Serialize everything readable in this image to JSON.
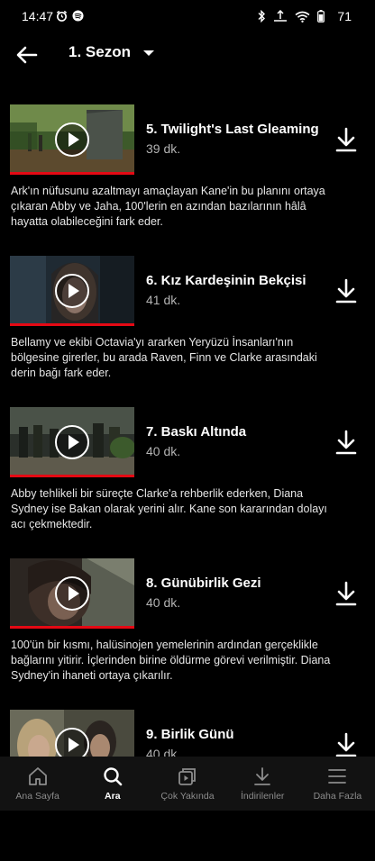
{
  "status_bar": {
    "time": "14:47",
    "battery": "71",
    "icons": [
      "alarm-icon",
      "spotify-icon",
      "bluetooth-icon",
      "data-saver-icon",
      "wifi-icon",
      "battery-icon"
    ]
  },
  "header": {
    "season_label": "1. Sezon",
    "back_icon": "arrow-left-icon",
    "dropdown_icon": "caret-down-icon"
  },
  "episodes": [
    {
      "title": "5. Twilight's Last Gleaming",
      "duration": "39 dk.",
      "description": "Ark'ın nüfusunu azaltmayı amaçlayan Kane'in bu planını ortaya çıkaran Abby ve Jaha, 100'lerin en azından bazılarının hâlâ hayatta olabileceğini fark eder.",
      "progress": 1.0
    },
    {
      "title": "6. Kız Kardeşinin Bekçisi",
      "duration": "41 dk.",
      "description": "Bellamy ve ekibi Octavia'yı ararken Yeryüzü İnsanları'nın bölgesine girerler, bu arada Raven, Finn ve Clarke arasındaki derin bağı fark eder.",
      "progress": 1.0
    },
    {
      "title": "7. Baskı Altında",
      "duration": "40 dk.",
      "description": "Abby tehlikeli bir süreçte Clarke'a rehberlik ederken, Diana Sydney ise Bakan olarak yerini alır. Kane son kararından dolayı acı çekmektedir.",
      "progress": 1.0
    },
    {
      "title": "8. Günübirlik Gezi",
      "duration": "40 dk.",
      "description": "100'ün bir kısmı, halüsinojen yemelerinin ardından gerçeklikle bağlarını yitirir. İçlerinden birine öldürme görevi verilmiştir. Diana Sydney'in ihaneti ortaya çıkarılır.",
      "progress": 1.0
    },
    {
      "title": "9. Birlik Günü",
      "duration": "40 dk.",
      "description": "",
      "progress": 0
    }
  ],
  "bottom_nav": [
    {
      "label": "Ana Sayfa",
      "icon": "home-icon",
      "active": false
    },
    {
      "label": "Ara",
      "icon": "search-icon",
      "active": true
    },
    {
      "label": "Çok Yakında",
      "icon": "coming-soon-icon",
      "active": false
    },
    {
      "label": "İndirilenler",
      "icon": "downloads-icon",
      "active": false
    },
    {
      "label": "Daha Fazla",
      "icon": "menu-icon",
      "active": false
    }
  ],
  "colors": {
    "background": "#000000",
    "accent_red": "#e50914",
    "secondary_text": "#b3b3b3",
    "nav_background": "#121212"
  }
}
